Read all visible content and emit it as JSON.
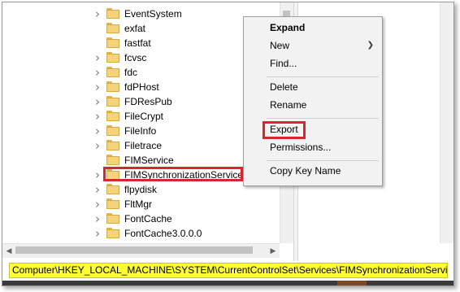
{
  "tree": {
    "items": [
      {
        "label": "EventSystem",
        "expandable": true
      },
      {
        "label": "exfat",
        "expandable": false
      },
      {
        "label": "fastfat",
        "expandable": false
      },
      {
        "label": "fcvsc",
        "expandable": true
      },
      {
        "label": "fdc",
        "expandable": true
      },
      {
        "label": "fdPHost",
        "expandable": true
      },
      {
        "label": "FDResPub",
        "expandable": true
      },
      {
        "label": "FileCrypt",
        "expandable": true
      },
      {
        "label": "FileInfo",
        "expandable": true
      },
      {
        "label": "Filetrace",
        "expandable": true
      },
      {
        "label": "FIMService",
        "expandable": false
      },
      {
        "label": "FIMSynchronizationService",
        "expandable": true,
        "selected": true
      },
      {
        "label": "flpydisk",
        "expandable": true
      },
      {
        "label": "FltMgr",
        "expandable": true
      },
      {
        "label": "FontCache",
        "expandable": true
      },
      {
        "label": "FontCache3.0.0.0",
        "expandable": true
      }
    ]
  },
  "context_menu": {
    "expand": "Expand",
    "new": "New",
    "find": "Find...",
    "delete": "Delete",
    "rename": "Rename",
    "export": "Export",
    "permissions": "Permissions...",
    "copy_key_name": "Copy Key Name"
  },
  "address_bar": {
    "path": "Computer\\HKEY_LOCAL_MACHINE\\SYSTEM\\CurrentControlSet\\Services\\FIMSynchronizationService"
  },
  "icons": {
    "expander": "chevron-right-icon",
    "folder": "folder-icon",
    "submenu": "chevron-right-icon"
  },
  "colors": {
    "highlight_border": "#d7262c",
    "address_background": "#ffff33",
    "folder": "#f5d37a"
  }
}
